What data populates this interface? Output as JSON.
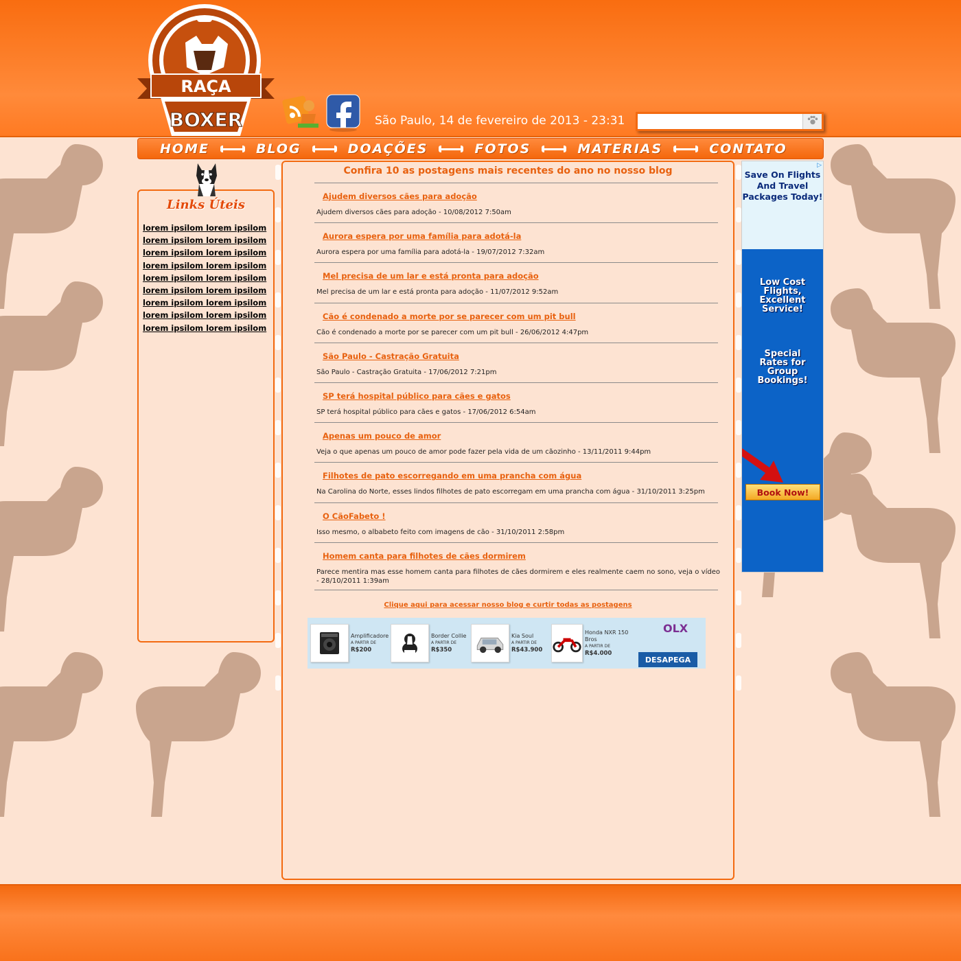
{
  "header": {
    "logo": {
      "line1": "RAÇA",
      "line2": "BOXER"
    },
    "date_text": "São Paulo, 14 de fevereiro de 2013 - 23:31",
    "search": {
      "placeholder": ""
    }
  },
  "nav": {
    "items": [
      "HOME",
      "BLOG",
      "DOAÇÕES",
      "FOTOS",
      "MATERIAS",
      "CONTATO"
    ]
  },
  "sidebar": {
    "title": "Links Úteis",
    "links": [
      "lorem ipsilom lorem ipsilom",
      "lorem ipsilom lorem ipsilom",
      "lorem ipsilom lorem ipsilom",
      "lorem ipsilom lorem ipsilom",
      "lorem ipsilom lorem ipsilom",
      "lorem ipsilom lorem ipsilom",
      "lorem ipsilom lorem ipsilom",
      "lorem ipsilom lorem ipsilom",
      "lorem ipsilom lorem ipsilom"
    ]
  },
  "main": {
    "title": "Confira 10 as postagens mais recentes do ano no nosso blog",
    "posts": [
      {
        "title": "Ajudem diversos cães para adoção",
        "desc": "Ajudem diversos cães para adoção - 10/08/2012 7:50am"
      },
      {
        "title": "Aurora espera por uma família para adotá-la",
        "desc": "Aurora espera por uma família para adotá-la - 19/07/2012 7:32am"
      },
      {
        "title": "Mel precisa de um lar e está pronta para adoção",
        "desc": "Mel precisa de um lar e está pronta para adoção - 11/07/2012 9:52am"
      },
      {
        "title": "Cão é condenado a morte por se parecer com um pit bull",
        "desc": "Cão é condenado a morte por se parecer com um pit bull - 26/06/2012 4:47pm"
      },
      {
        "title": "São Paulo - Castração Gratuita",
        "desc": "São Paulo - Castração Gratuita - 17/06/2012 7:21pm"
      },
      {
        "title": "SP terá hospital público para cães e gatos",
        "desc": "SP terá hospital público para cães e gatos - 17/06/2012 6:54am"
      },
      {
        "title": "Apenas um pouco de amor",
        "desc": "Veja o que apenas um pouco de amor pode fazer pela vida de um cãozinho - 13/11/2011 9:44pm"
      },
      {
        "title": "Filhotes de pato escorregando em uma prancha com água",
        "desc": "Na Carolina do Norte, esses lindos filhotes de pato escorregam em uma prancha com água - 31/10/2011 3:25pm"
      },
      {
        "title": "O CãoFabeto !",
        "desc": "Isso mesmo, o albabeto feito com imagens de cão - 31/10/2011 2:58pm"
      },
      {
        "title": "Homem canta para filhotes de cães dormirem",
        "desc": "Parece mentira mas esse homem canta para filhotes de cães dormirem e eles realmente caem no sono, veja o vídeo - 28/10/2011 1:39am"
      }
    ],
    "blog_link": "Clique aqui para acessar nosso blog e curtir todas as postagens"
  },
  "olx_banner": {
    "items": [
      {
        "name": "Amplificadore",
        "from": "A PARTIR DE",
        "price": "R$200",
        "icon": "amplifier-icon"
      },
      {
        "name": "Border Collie",
        "from": "A PARTIR DE",
        "price": "R$350",
        "icon": "dog-icon"
      },
      {
        "name": "Kia Soul",
        "from": "A PARTIR DE",
        "price": "R$43.900",
        "icon": "car-icon"
      },
      {
        "name": "Honda NXR 150 Bros",
        "from": "A PARTIR DE",
        "price": "R$4.000",
        "icon": "motorcycle-icon"
      }
    ],
    "brand": "OLX",
    "tagline": "DESAPEGA"
  },
  "right_ad": {
    "choices": "▷",
    "headline": [
      "Save On Flights",
      "And Travel",
      "Packages Today!"
    ],
    "block1": [
      "Low Cost",
      "Flights,",
      "Excellent",
      "Service!"
    ],
    "block2": [
      "Special",
      "Rates for",
      "Group",
      "Bookings!"
    ],
    "button": "Book Now!"
  },
  "colors": {
    "accent": "#f36a10",
    "link": "#e8610f",
    "background": "#fde3d2",
    "dog_silhouette": "#c9a58e"
  }
}
